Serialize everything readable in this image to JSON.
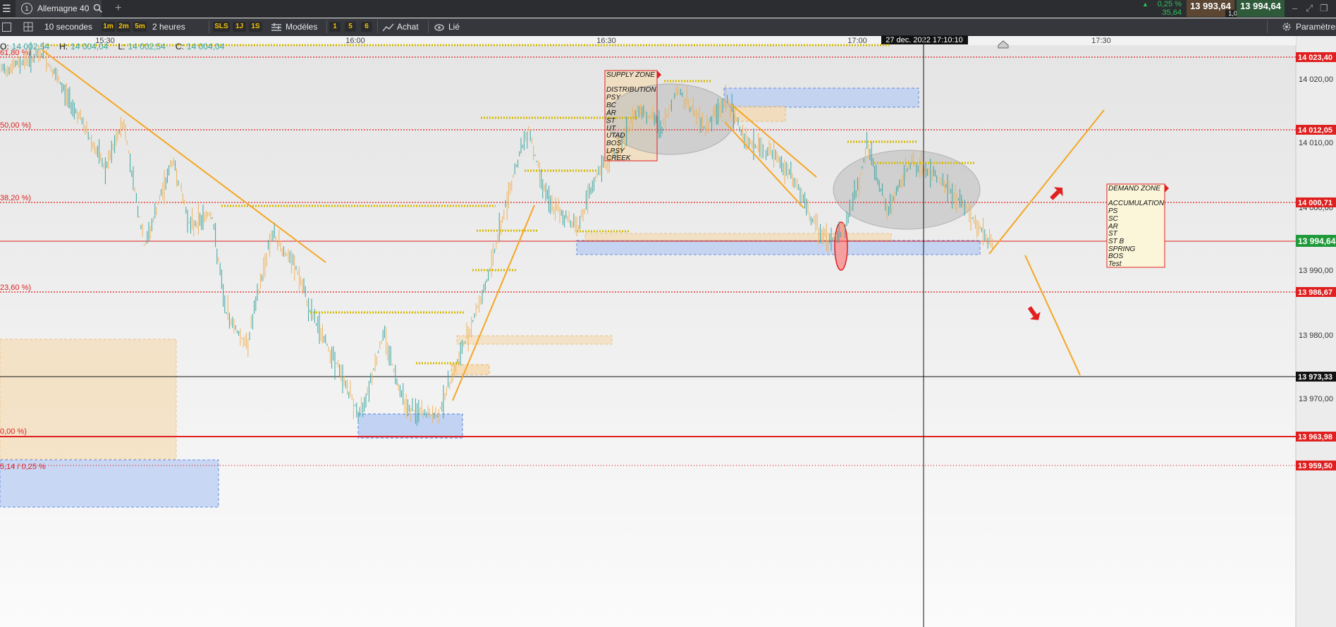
{
  "topbar": {
    "menu_icon": "hamburger-menu-icon",
    "tab_number": "1",
    "instrument": "Allemagne 40",
    "change_pct": "0,25 %",
    "change_abs": "35,64",
    "bid": "13 993,64",
    "spread": "1,00",
    "ask": "13 994,64"
  },
  "toolbar": {
    "interval": "10 secondes",
    "buttons": [
      "1m",
      "2m",
      "5m"
    ],
    "range": "2 heures",
    "order_buttons": [
      "SLS",
      "1J",
      "1S"
    ],
    "templates": "Modèles",
    "num_buttons": [
      "1",
      "5",
      "6"
    ],
    "buy": "Achat",
    "linked": "Lié",
    "settings": "Paramètres"
  },
  "chart": {
    "time_labels": [
      "15:30",
      "16:00",
      "16:30",
      "17:00",
      "17:30"
    ],
    "cursor_time": "27 dec. 2022 17:10:10",
    "ohlc": {
      "o_label": "O:",
      "o": "14 002,54",
      "h_label": "H:",
      "h": "14 004,04",
      "l_label": "L:",
      "l": "14 002,54",
      "c_label": "C:",
      "c": "14 004,04"
    },
    "fib_labels": [
      "61,80 %)",
      "50,00 %)",
      "38,20 %)",
      "23,60 %)",
      "0,00 %)",
      "5,14 / 0,25 %"
    ],
    "price_axis": [
      "14 020,00",
      "14 010,00",
      "14 000,00",
      "13 990,00",
      "13 980,00",
      "13 970,00"
    ],
    "level_tags": [
      "14 023,40",
      "14 012,05",
      "14 000,71",
      "13 986,67",
      "13 963,98",
      "13 959,50"
    ],
    "current_price": "13 994,64",
    "cursor_price": "13 973,33",
    "supply_zone": {
      "title": "SUPPLY ZONE",
      "lines": [
        "DISTRIBUTION",
        "PSY",
        "BC",
        "AR",
        "ST",
        "UT",
        "UTAD",
        "BOS",
        "LPSY",
        "CREEK"
      ]
    },
    "demand_zone": {
      "title": "DEMAND ZONE",
      "lines": [
        "ACCUMULATION",
        "PS",
        "SC",
        "AR",
        "ST",
        "ST B",
        "SPRING",
        "BOS",
        "Test"
      ]
    },
    "colors": {
      "up": "#3aa6a0",
      "down": "#efb35a",
      "trend": "#f5a623",
      "fib": "#e02020",
      "zone_blue": "#b9cdf3",
      "zone_orange": "#f6d9ac"
    }
  }
}
